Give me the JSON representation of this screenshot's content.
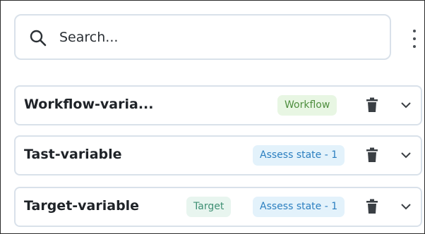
{
  "search": {
    "placeholder": "Search..."
  },
  "variables": [
    {
      "name": "Workflow-varia...",
      "tags": [
        {
          "label": "Workflow",
          "kind": "workflow"
        }
      ]
    },
    {
      "name": "Tast-variable",
      "tags": [
        {
          "label": "Assess state - 1",
          "kind": "assess"
        }
      ]
    },
    {
      "name": "Target-variable",
      "tags": [
        {
          "label": "Target",
          "kind": "target"
        },
        {
          "label": "Assess state - 1",
          "kind": "assess"
        }
      ]
    }
  ],
  "icons": {
    "search": "search-icon",
    "more": "more-vertical-icon",
    "delete": "trash-icon",
    "expand": "chevron-down-icon"
  },
  "colors": {
    "border": "#d9e1ea",
    "workflow_badge_bg": "#e8f6e3",
    "workflow_badge_text": "#4f8f3f",
    "target_badge_bg": "#e8f5ef",
    "target_badge_text": "#3e8f73",
    "assess_badge_bg": "#e3f2fb",
    "assess_badge_text": "#2b7fc0"
  }
}
